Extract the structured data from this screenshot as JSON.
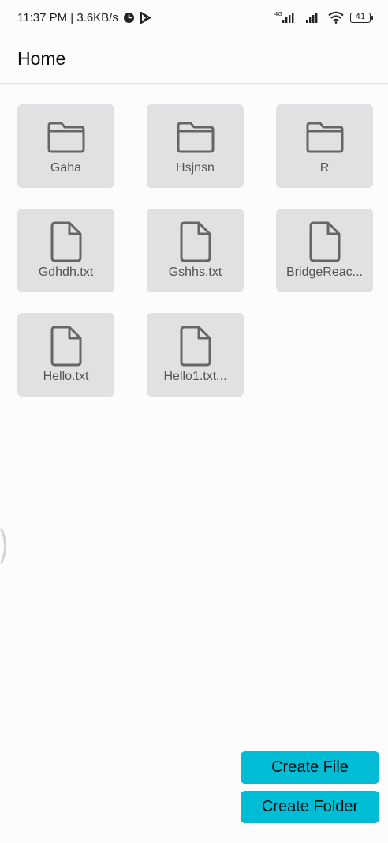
{
  "status_bar": {
    "time": "11:37 PM | 3.6KB/s",
    "network_label": "4G",
    "battery": "41",
    "icons": [
      "data-saver-icon",
      "play-store-icon",
      "signal-4g-icon",
      "signal-icon",
      "wifi-icon",
      "battery-icon"
    ]
  },
  "app_bar": {
    "title": "Home"
  },
  "items": [
    {
      "type": "folder",
      "name": "Gaha"
    },
    {
      "type": "folder",
      "name": "Hsjnsn"
    },
    {
      "type": "folder",
      "name": "R"
    },
    {
      "type": "file",
      "name": "Gdhdh.txt"
    },
    {
      "type": "file",
      "name": "Gshhs.txt"
    },
    {
      "type": "file",
      "name": "BridgeReac..."
    },
    {
      "type": "file",
      "name": "Hello.txt"
    },
    {
      "type": "file",
      "name": "Hello1.txt..."
    }
  ],
  "actions": {
    "create_file": "Create File",
    "create_folder": "Create Folder"
  },
  "colors": {
    "accent": "#00bcd4",
    "tile_bg": "#e1e1e3",
    "icon_stroke": "#666666",
    "background": "#fdfcfd"
  }
}
